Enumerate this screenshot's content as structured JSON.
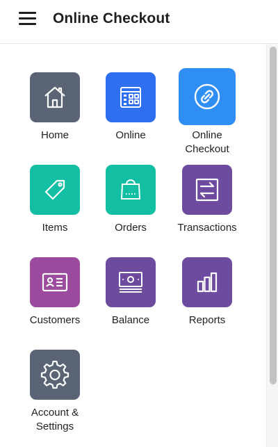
{
  "header": {
    "title": "Online Checkout",
    "menu_icon": "hamburger-menu-icon"
  },
  "colors": {
    "home": "#5a6475",
    "online": "#2d6ff0",
    "online_checkout": "#2f8ef3",
    "items": "#12bfa3",
    "orders": "#12bfa3",
    "transactions": "#6d4c9f",
    "customers": "#9b4a9e",
    "balance": "#6d4c9f",
    "reports": "#6d4c9f",
    "account_settings": "#5a6475"
  },
  "tiles": [
    {
      "label": "Home",
      "icon": "house-icon",
      "selected": false
    },
    {
      "label": "Online",
      "icon": "grid-browser-icon",
      "selected": false
    },
    {
      "label": "Online\nCheckout",
      "icon": "link-icon",
      "selected": true
    },
    {
      "label": "Items",
      "icon": "tag-icon",
      "selected": false
    },
    {
      "label": "Orders",
      "icon": "shopping-bag-icon",
      "selected": false
    },
    {
      "label": "Transactions",
      "icon": "transfer-arrows-icon",
      "selected": false
    },
    {
      "label": "Customers",
      "icon": "id-card-icon",
      "selected": false
    },
    {
      "label": "Balance",
      "icon": "cash-icon",
      "selected": false
    },
    {
      "label": "Reports",
      "icon": "bar-chart-icon",
      "selected": false
    },
    {
      "label": "Account &\nSettings",
      "icon": "gear-icon",
      "selected": false
    }
  ]
}
